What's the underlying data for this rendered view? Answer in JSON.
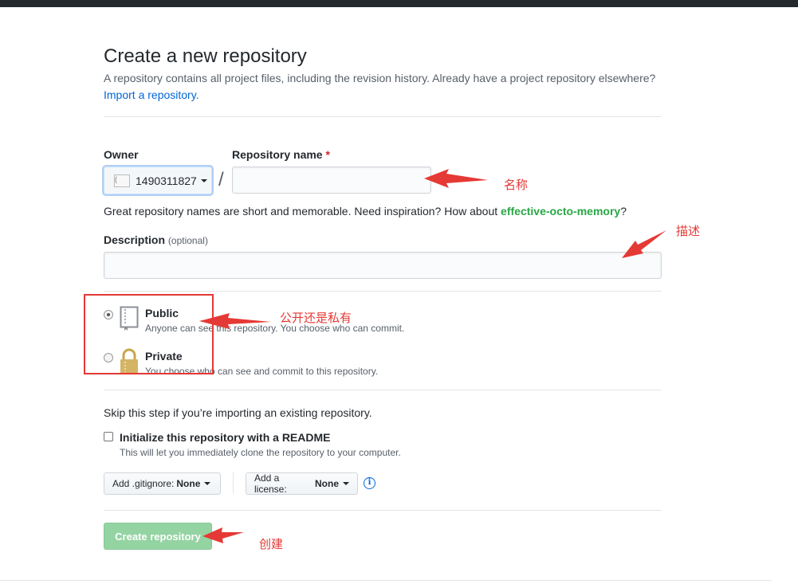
{
  "page": {
    "title": "Create a new repository",
    "subtitle": "A repository contains all project files, including the revision history. Already have a project repository elsewhere?",
    "import_link": "Import a repository."
  },
  "owner": {
    "label": "Owner",
    "avatar_alt": "(",
    "value": "1490311827"
  },
  "repo_name": {
    "label": "Repository name",
    "required_mark": "*",
    "value": "",
    "hint_prefix": "Great repository names are short and memorable. Need inspiration? How about ",
    "hint_suggestion": "effective-octo-memory",
    "hint_suffix": "?"
  },
  "description": {
    "label": "Description",
    "optional": "(optional)",
    "value": ""
  },
  "visibility": {
    "public": {
      "label": "Public",
      "note": "Anyone can see this repository. You choose who can commit.",
      "selected": true
    },
    "private": {
      "label": "Private",
      "note": "You choose who can see and commit to this repository.",
      "selected": false
    }
  },
  "init": {
    "skip_text": "Skip this step if you’re importing an existing repository.",
    "readme_label": "Initialize this repository with a README",
    "readme_note": "This will let you immediately clone the repository to your computer.",
    "readme_checked": false
  },
  "gitignore": {
    "label": "Add .gitignore:",
    "value": "None"
  },
  "license": {
    "label": "Add a license:",
    "value": "None"
  },
  "info_icon": "i",
  "create_button": "Create repository",
  "annotations": {
    "name": "名称",
    "description": "描述",
    "visibility": "公开还是私有",
    "create": "创建"
  },
  "colors": {
    "accent_link": "#0366d6",
    "suggestion_green": "#28a745",
    "create_button": "#94d3a2",
    "annotation_red": "#e53935",
    "header_dark": "#24292e"
  }
}
